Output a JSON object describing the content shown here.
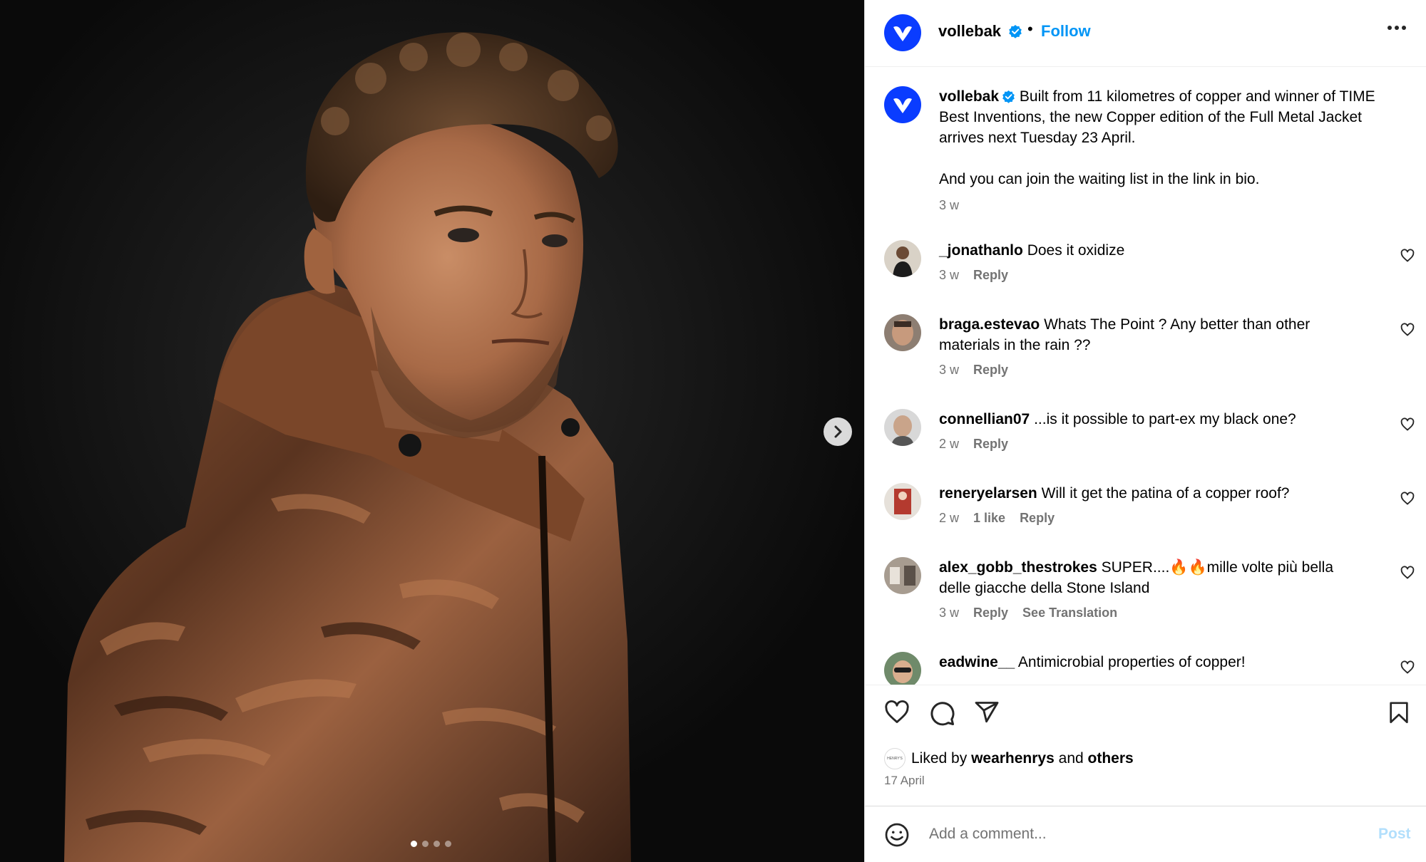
{
  "post": {
    "username": "vollebak",
    "follow_label": "Follow",
    "separator": "•",
    "caption_line1": "Built from 11 kilometres of copper and winner of TIME Best Inventions, the new Copper edition of the Full Metal Jacket arrives next Tuesday 23 April.",
    "caption_line2": "And you can join the waiting list in the link in bio.",
    "caption_age": "3 w",
    "liked_prefix": "Liked by",
    "liked_user": "wearhenrys",
    "liked_and": "and",
    "liked_others": "others",
    "liked_avatar_text": "HENRY'S",
    "date": "17 April"
  },
  "comments": [
    {
      "user": "_jonathanlo",
      "text": "Does it oxidize",
      "age": "3 w",
      "likes": "",
      "reply": "Reply",
      "extra": ""
    },
    {
      "user": "braga.estevao",
      "text": "Whats The Point ? Any better than other materials in the rain ??",
      "age": "3 w",
      "likes": "",
      "reply": "Reply",
      "extra": ""
    },
    {
      "user": "connellian07",
      "text": "...is it possible to part-ex my black one?",
      "age": "2 w",
      "likes": "",
      "reply": "Reply",
      "extra": ""
    },
    {
      "user": "reneryelarsen",
      "text": "Will it get the patina of a copper roof?",
      "age": "2 w",
      "likes": "1 like",
      "reply": "Reply",
      "extra": ""
    },
    {
      "user": "alex_gobb_thestrokes",
      "text": "SUPER....🔥🔥mille volte più bella delle giacche della Stone Island",
      "age": "3 w",
      "likes": "",
      "reply": "Reply",
      "extra": "See Translation"
    },
    {
      "user": "eadwine__",
      "text": "Antimicrobial properties of copper!",
      "age": "",
      "likes": "",
      "reply": "",
      "extra": ""
    }
  ],
  "composer": {
    "placeholder": "Add a comment...",
    "post_label": "Post"
  },
  "carousel": {
    "total": 4,
    "active": 1
  },
  "colors": {
    "brand_blue": "#0a3cff",
    "link_blue": "#0095f6",
    "verified_blue": "#0095f6",
    "muted": "#737373",
    "post_disabled": "#b2dffc"
  },
  "icons": [
    "verified-badge-icon",
    "more-options-icon",
    "chevron-right-icon",
    "heart-icon",
    "comment-icon",
    "share-icon",
    "bookmark-icon",
    "emoji-icon"
  ]
}
